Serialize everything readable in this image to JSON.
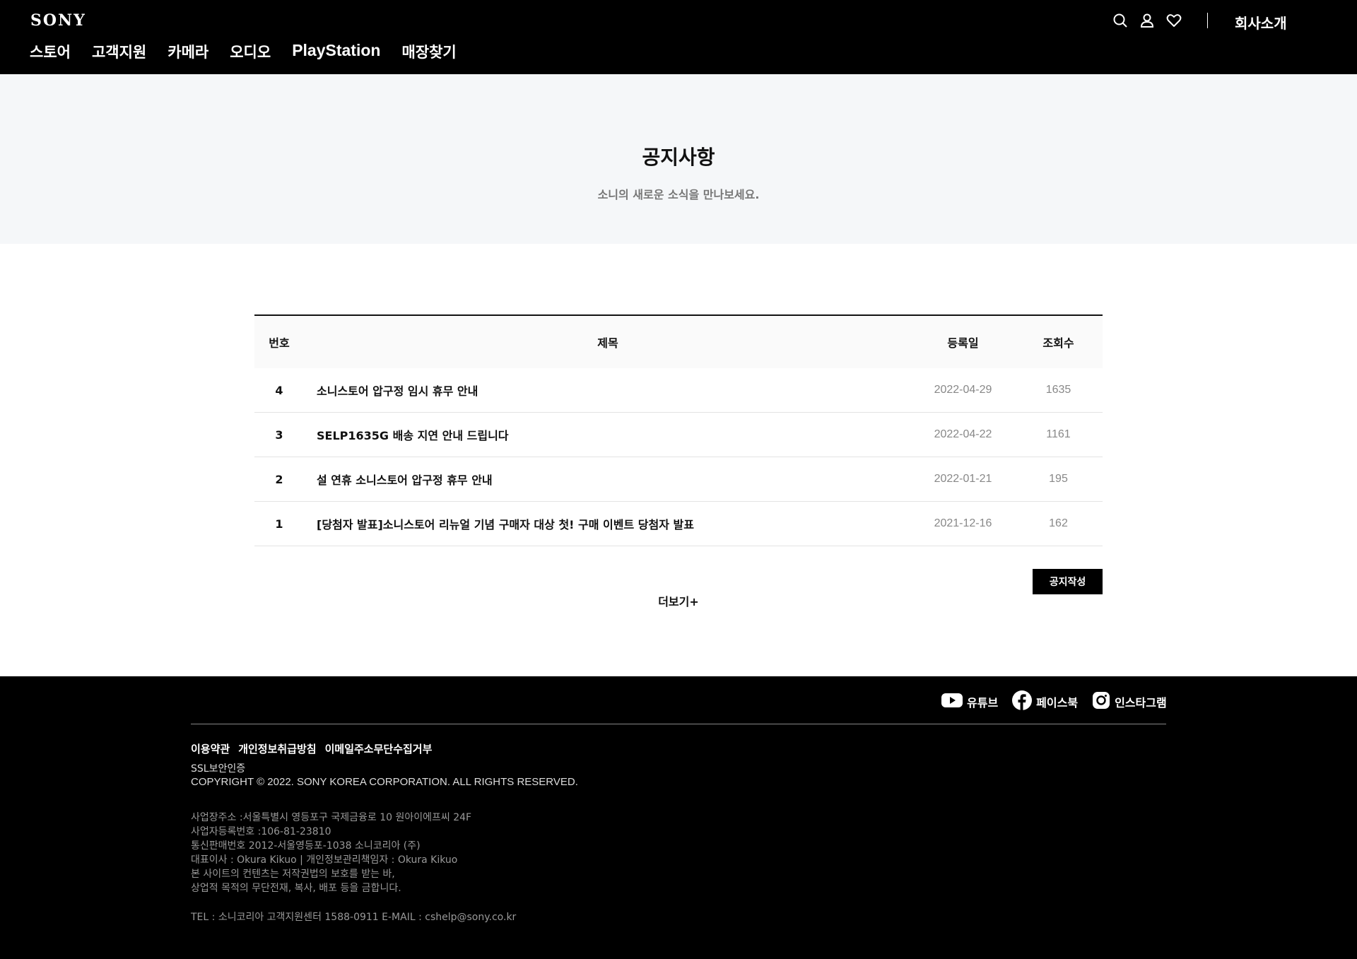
{
  "header": {
    "logo": "SONY",
    "nav": [
      "스토어",
      "고객지원",
      "카메라",
      "오디오",
      "PlayStation",
      "매장찾기"
    ],
    "utility_icons": [
      "search-icon",
      "user-icon",
      "heart-icon"
    ],
    "company_link": "회사소개"
  },
  "hero": {
    "title": "공지사항",
    "subtitle": "소니의 새로운 소식을 만나보세요."
  },
  "board": {
    "columns": {
      "no": "번호",
      "title": "제목",
      "date": "등록일",
      "views": "조회수"
    },
    "rows": [
      {
        "no": "4",
        "title": "소니스토어 압구정 임시 휴무 안내",
        "date": "2022-04-29",
        "views": "1635"
      },
      {
        "no": "3",
        "title": "SELP1635G 배송 지연 안내 드립니다",
        "date": "2022-04-22",
        "views": "1161"
      },
      {
        "no": "2",
        "title": "설 연휴 소니스토어 압구정 휴무 안내",
        "date": "2022-01-21",
        "views": "195"
      },
      {
        "no": "1",
        "title": "[당첨자 발표]소니스토어 리뉴얼 기념 구매자 대상 첫! 구매 이벤트 당첨자 발표",
        "date": "2021-12-16",
        "views": "162"
      }
    ],
    "write_button": "공지작성",
    "more_label": "더보기+"
  },
  "footer": {
    "social": [
      {
        "icon": "youtube-icon",
        "label": "유튜브"
      },
      {
        "icon": "facebook-icon",
        "label": "페이스북"
      },
      {
        "icon": "instagram-icon",
        "label": "인스타그램"
      }
    ],
    "links": [
      "이용약관",
      "개인정보취급방침",
      "이메일주소무단수집거부"
    ],
    "ssl": "SSL보안인증",
    "copyright": "COPYRIGHT © 2022. SONY KOREA CORPORATION. ALL RIGHTS RESERVED.",
    "info_lines": [
      "사업장주소 :서울특별시 영등포구 국제금융로 10 원아이에프씨 24F",
      "사업자등록번호 :106-81-23810",
      "통신판매번호 2012-서울영등포-1038 소니코리아 (주)",
      "대표이사 : Okura Kikuo | 개인정보관리책임자 : Okura Kikuo",
      "본 사이트의 컨텐츠는 저작권법의 보호를 받는 바,",
      "상업적 목적의 무단전재, 복사, 배포 등을 금합니다."
    ],
    "contact": "TEL : 소니코리아 고객지원센터 1588-0911 E-MAIL : cshelp@sony.co.kr"
  }
}
